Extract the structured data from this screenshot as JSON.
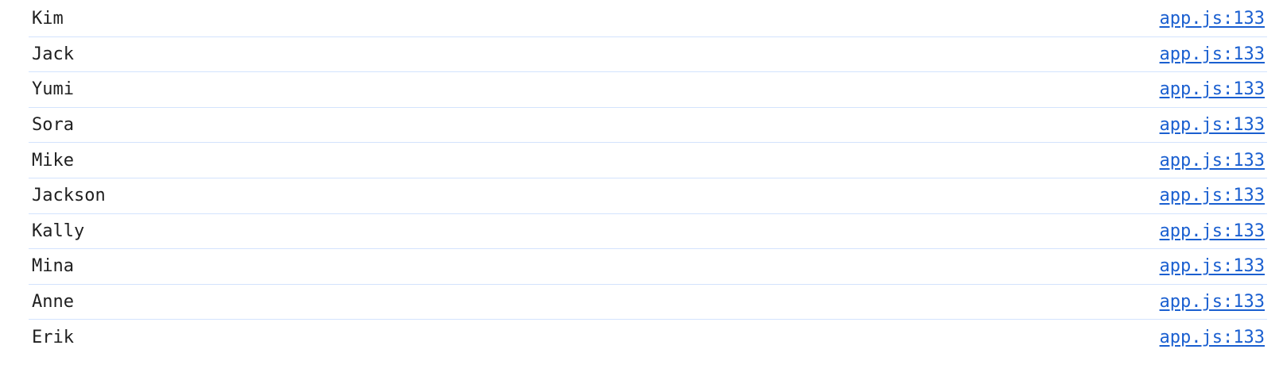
{
  "console": {
    "rows": [
      {
        "message": "Kim",
        "source": "app.js:133"
      },
      {
        "message": "Jack",
        "source": "app.js:133"
      },
      {
        "message": "Yumi",
        "source": "app.js:133"
      },
      {
        "message": "Sora",
        "source": "app.js:133"
      },
      {
        "message": "Mike",
        "source": "app.js:133"
      },
      {
        "message": "Jackson",
        "source": "app.js:133"
      },
      {
        "message": "Kally",
        "source": "app.js:133"
      },
      {
        "message": "Mina",
        "source": "app.js:133"
      },
      {
        "message": "Anne",
        "source": "app.js:133"
      },
      {
        "message": "Erik",
        "source": "app.js:133"
      }
    ]
  },
  "colors": {
    "text": "#1f1f1f",
    "link": "#1a5fd0",
    "divider": "#d3e3fd"
  }
}
